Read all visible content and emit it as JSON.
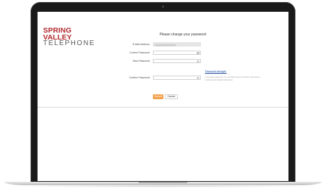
{
  "logo": {
    "line1": "SPRING VALLEY",
    "line2": "TELEPHONE"
  },
  "form": {
    "title": "Please change your password",
    "email_label": "E-Mail Address:",
    "email_value_obscured": true,
    "current_password_label": "Current Password:",
    "new_password_label": "New Password:",
    "confirm_password_label": "Confirm Password:",
    "password_strength_link": "Password strength:",
    "password_hint": "A stronger password: try to include upper and lower case letters, numbers and special characters."
  },
  "buttons": {
    "submit": "Submit",
    "cancel": "Cancel"
  },
  "colors": {
    "brand_red": "#b3282d",
    "submit_orange": "#f2a04a",
    "link_blue": "#1d4ea8"
  },
  "icons": {
    "password_field_icon": "eye-icon",
    "current_password_icon": "keyboard-icon"
  }
}
